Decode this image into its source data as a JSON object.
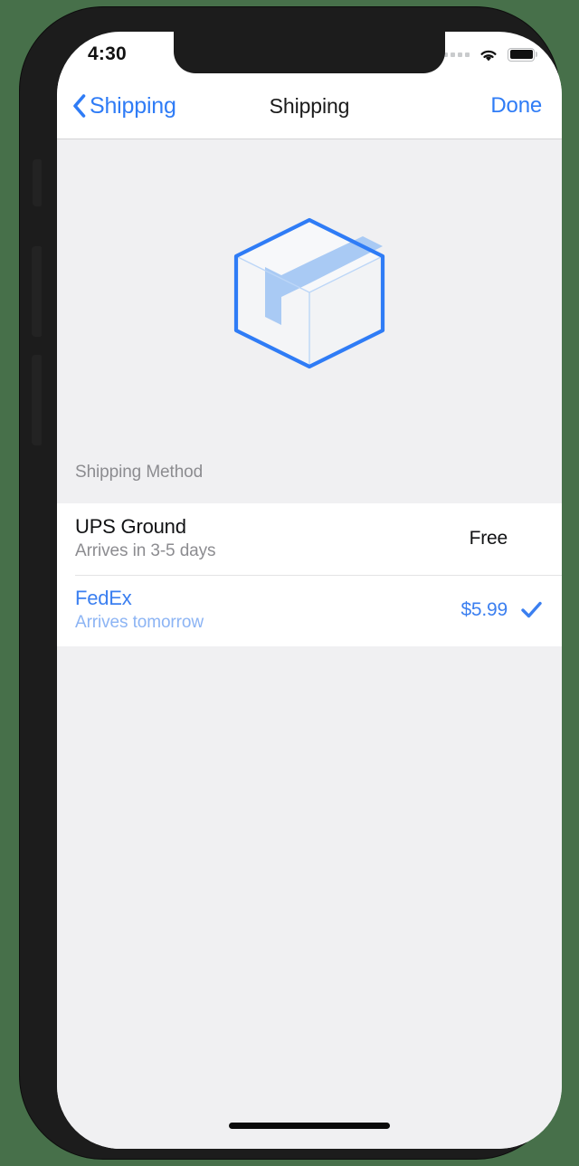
{
  "device": {
    "side_buttons": [
      "mute-switch",
      "volume-up-button",
      "volume-down-button",
      "power-button"
    ],
    "home_indicator": "home-indicator"
  },
  "statusbar": {
    "time": "4:30",
    "signal_icon": "signal-dots-icon",
    "signal_dots": 4,
    "wifi_icon": "wifi-icon",
    "battery_icon": "battery-icon",
    "battery_level": 100
  },
  "navbar": {
    "back_icon": "chevron-left-icon",
    "back_label": "Shipping",
    "title": "Shipping",
    "done_label": "Done"
  },
  "hero": {
    "icon": "package-box-icon",
    "outline_color": "#2f7cf6",
    "tape_color": "#a9caf4",
    "face_color": "#f6f7f9"
  },
  "section": {
    "header": "Shipping Method"
  },
  "shipping_methods": [
    {
      "name": "UPS Ground",
      "eta": "Arrives in 3-5 days",
      "price": "Free",
      "selected": false
    },
    {
      "name": "FedEx",
      "eta": "Arrives tomorrow",
      "price": "$5.99",
      "selected": true,
      "check_icon": "checkmark-icon"
    }
  ],
  "colors": {
    "accent": "#2f7cf6",
    "selected_text": "#3b7ff0",
    "selected_subtext": "#8cb4f4",
    "primary_text": "#111214",
    "secondary_text": "#8c8c90",
    "background": "#f0f0f2",
    "surface": "#ffffff",
    "page_backdrop": "#47704a"
  }
}
